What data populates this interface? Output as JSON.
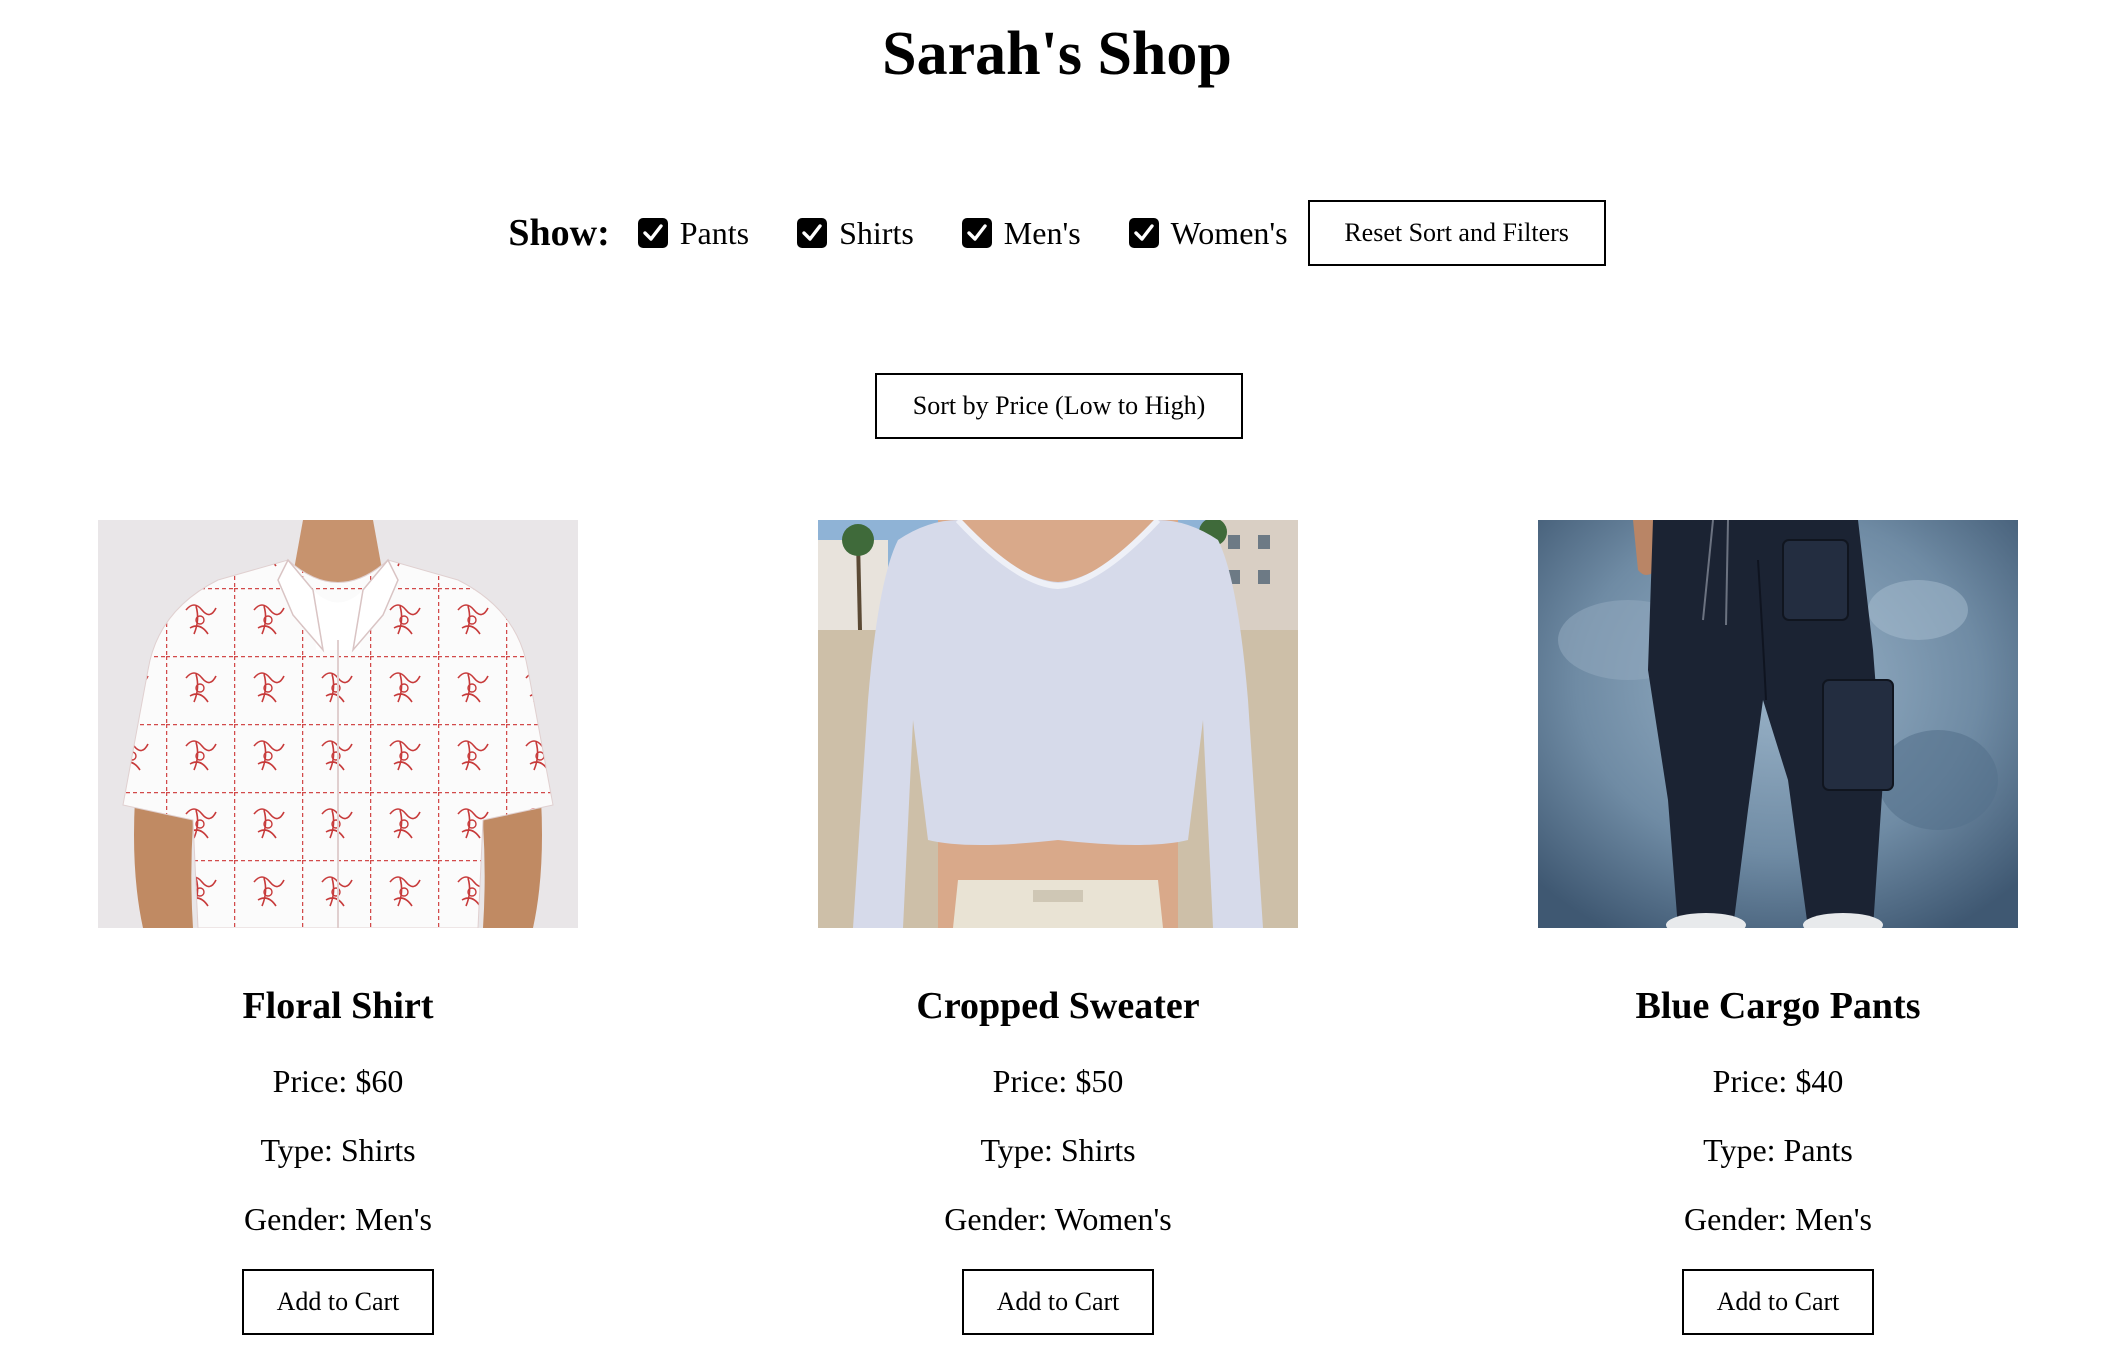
{
  "header": {
    "title": "Sarah's Shop"
  },
  "filters": {
    "show_label": "Show:",
    "options": [
      {
        "label": "Pants",
        "checked": true
      },
      {
        "label": "Shirts",
        "checked": true
      },
      {
        "label": "Men's",
        "checked": true
      },
      {
        "label": "Women's",
        "checked": true
      }
    ],
    "reset_label": "Reset Sort and Filters"
  },
  "sort": {
    "label": "Sort by Price (Low to High)"
  },
  "products": [
    {
      "name": "Floral Shirt",
      "price": "Price: $60",
      "type": "Type: Shirts",
      "gender": "Gender: Men's",
      "cart_label": "Add to Cart"
    },
    {
      "name": "Cropped Sweater",
      "price": "Price: $50",
      "type": "Type: Shirts",
      "gender": "Gender: Women's",
      "cart_label": "Add to Cart"
    },
    {
      "name": "Blue Cargo Pants",
      "price": "Price: $40",
      "type": "Type: Pants",
      "gender": "Gender: Men's",
      "cart_label": "Add to Cart"
    }
  ],
  "colors": {
    "background": "#ffffff",
    "text": "#000000",
    "checkbox_fill": "#000000"
  }
}
